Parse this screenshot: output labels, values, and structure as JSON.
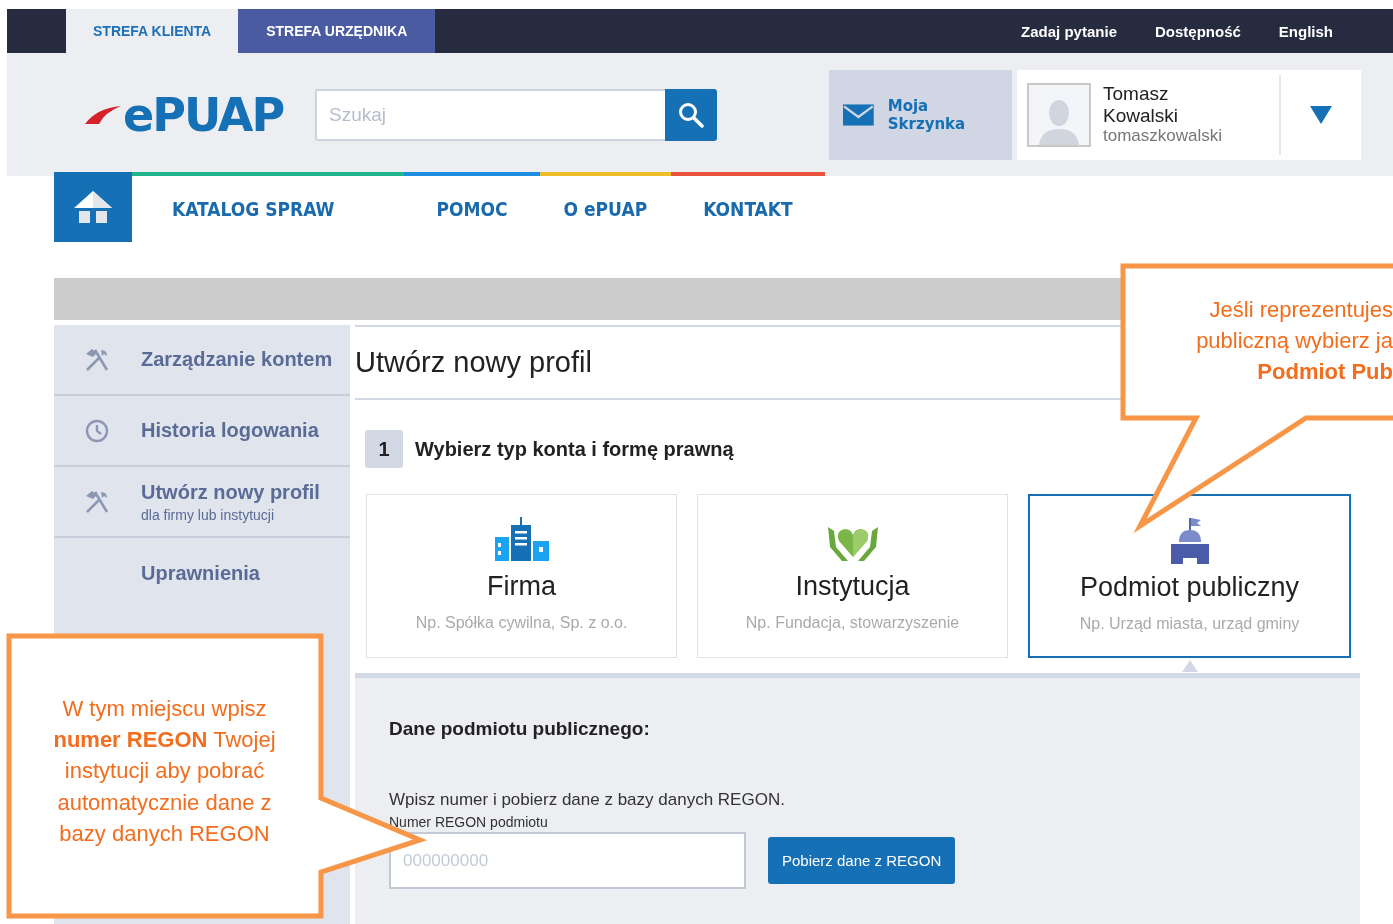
{
  "top_bar": {
    "zones": [
      {
        "label": "STREFA KLIENTA",
        "selected": true
      },
      {
        "label": "STREFA URZĘDNIKA",
        "selected": false
      }
    ],
    "links": [
      "Zadaj pytanie",
      "Dostępność",
      "English"
    ]
  },
  "header": {
    "logo": "ePUAP",
    "search": {
      "placeholder": "Szukaj"
    },
    "inbox": "Moja Skrzynka",
    "user": {
      "first_name": "Tomasz",
      "last_name": "Kowalski",
      "login": "tomaszkowalski"
    }
  },
  "nav": [
    {
      "label": "KATALOG SPRAW",
      "color": "#1fb58a"
    },
    {
      "label": "POMOC",
      "color": "#1e8fe0"
    },
    {
      "label": "O ePUAP",
      "color": "#f0bd2a"
    },
    {
      "label": "KONTAKT",
      "color": "#e8523a"
    }
  ],
  "sidebar": {
    "items": [
      {
        "kind": "tools",
        "label": "Zarządzanie kontem"
      },
      {
        "kind": "clock",
        "label": "Historia logowania"
      },
      {
        "kind": "tools",
        "label": "Utwórz nowy profil",
        "sublabel": "dla firmy lub instytucji"
      },
      {
        "kind": "plain",
        "label": "Uprawnienia"
      }
    ]
  },
  "main": {
    "title": "Utwórz nowy profil",
    "step": {
      "number": "1",
      "label": "Wybierz typ konta i formę prawną"
    },
    "options": [
      {
        "kind": "company",
        "title": "Firma",
        "subtitle": "Np. Spółka cywilna, Sp. z o.o.",
        "selected": false
      },
      {
        "kind": "institution",
        "title": "Instytucja",
        "subtitle": "Np. Fundacja, stowarzyszenie",
        "selected": false
      },
      {
        "kind": "public",
        "title": "Podmiot publiczny",
        "subtitle": "Np. Urząd miasta, urząd gminy",
        "selected": true
      }
    ],
    "details": {
      "heading": "Dane podmiotu publicznego:",
      "hint": "Wpisz numer i pobierz dane z bazy danych REGON.",
      "field_label": "Numer REGON podmiotu",
      "field_placeholder": "000000000",
      "button": "Pobierz dane z REGON"
    }
  },
  "callouts": [
    {
      "lines": [
        "Jeśli reprezentujes",
        "publiczną wybierz ja",
        "**Podmiot Pub**"
      ]
    },
    {
      "lines": [
        "W tym miejscu wpisz",
        "**numer REGON** Twojej",
        "instytucji aby pobrać",
        "automatycznie dane z",
        "bazy danych REGON"
      ]
    }
  ]
}
